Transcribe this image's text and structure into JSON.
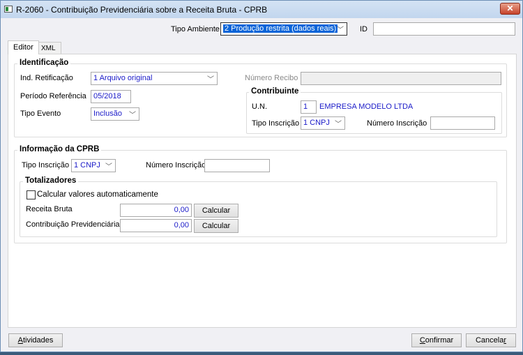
{
  "window": {
    "title": "R-2060 - Contribuição Previdenciária sobre a Receita Bruta - CPRB",
    "close": "✕"
  },
  "header": {
    "tipo_ambiente_label": "Tipo Ambiente",
    "tipo_ambiente_value": "2 Produção restrita (dados reais)",
    "id_label": "ID",
    "id_value": ""
  },
  "tabs": [
    {
      "label": "Editor"
    },
    {
      "label": "XML"
    }
  ],
  "identificacao": {
    "legend": "Identificação",
    "ind_retificacao_label": "Ind. Retificação",
    "ind_retificacao_value": "1 Arquivo original",
    "periodo_label": "Período Referência",
    "periodo_value": "05/2018",
    "tipo_evento_label": "Tipo Evento",
    "tipo_evento_value": "Inclusão",
    "numero_recibo_label": "Número Recibo",
    "numero_recibo_value": "",
    "contribuinte": {
      "legend": "Contribuinte",
      "un_label": "U.N.",
      "un_value": "1",
      "empresa": "EMPRESA MODELO LTDA",
      "tipo_inscricao_label": "Tipo Inscrição",
      "tipo_inscricao_value": "1 CNPJ",
      "numero_inscricao_label": "Número Inscrição",
      "numero_inscricao_value": ""
    }
  },
  "cprb": {
    "legend": "Informação da CPRB",
    "tipo_inscricao_label": "Tipo Inscrição",
    "tipo_inscricao_value": "1 CNPJ",
    "numero_inscricao_label": "Número Inscrição",
    "numero_inscricao_value": "",
    "totalizadores": {
      "legend": "Totalizadores",
      "auto_calc_label": "Calcular valores automaticamente",
      "auto_calc_checked": false,
      "receita_label": "Receita Bruta",
      "receita_value": "0,00",
      "contribuicao_label": "Contribuição Previdenciária",
      "contribuicao_value": "0,00",
      "calcular_label": "Calcular"
    }
  },
  "footer": {
    "atividades_first": "A",
    "atividades_rest": "tividades",
    "confirmar_first": "C",
    "confirmar_rest": "onfirmar",
    "cancelar_main": "Cancela",
    "cancelar_last": "r"
  }
}
